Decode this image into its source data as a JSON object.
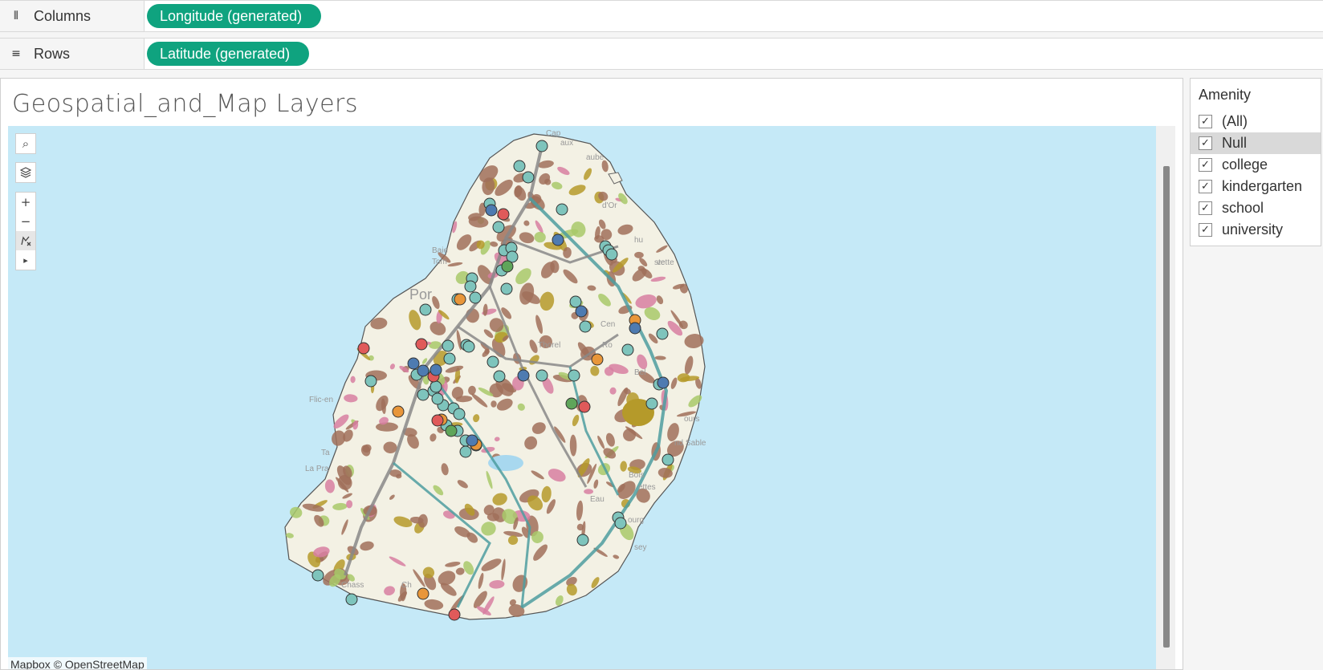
{
  "shelves": {
    "columns": {
      "label": "Columns",
      "icon": "columns-icon",
      "pill": "Longitude (generated)"
    },
    "rows": {
      "label": "Rows",
      "icon": "rows-icon",
      "pill": "Latitude (generated)"
    }
  },
  "sheet": {
    "title": "Geospatial_and_Map Layers",
    "attribution": "Mapbox © OpenStreetMap"
  },
  "map_toolbar": {
    "search_icon": "search-icon",
    "layers_icon": "layers-icon",
    "zoom_in": "+",
    "zoom_out": "−",
    "pan_icon": "pan-icon",
    "expand_icon": "▸"
  },
  "map_labels": [
    "Cap",
    "aux",
    "aube",
    "d'Or",
    "hu",
    "ste",
    "vette",
    "Baie",
    "Tom",
    "Por",
    "Cen",
    "Flic-en",
    "Ta",
    "La Pra",
    "ours",
    "nd Sable",
    "Bois",
    "ettes",
    "Eau",
    "ourg",
    "sey",
    "Chass",
    "Ch",
    "Thorel",
    "Ro",
    "Bel"
  ],
  "filter": {
    "title": "Amenity",
    "items": [
      {
        "label": "(All)",
        "checked": true
      },
      {
        "label": "Null",
        "checked": true
      },
      {
        "label": "college",
        "checked": true
      },
      {
        "label": "kindergarten",
        "checked": true
      },
      {
        "label": "school",
        "checked": true
      },
      {
        "label": "university",
        "checked": true
      }
    ]
  },
  "colors": {
    "pill": "#0fa37f",
    "water": "#c5e9f7",
    "land": "#f3f1e4",
    "urban": "#a0705a",
    "road": "#888888",
    "highway": "#4d9ea0",
    "mark_null": "#7ec4bc",
    "mark_college": "#e8963a",
    "mark_kindergarten": "#e05a5a",
    "mark_school": "#4e7bb1",
    "mark_university": "#5fa55a"
  }
}
